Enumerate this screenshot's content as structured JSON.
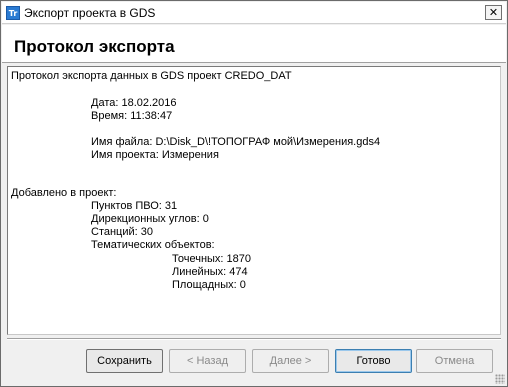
{
  "window": {
    "icon_text": "Tr",
    "title": "Экспорт проекта в GDS",
    "close_glyph": "✕"
  },
  "header": {
    "title": "Протокол экспорта"
  },
  "log": {
    "heading": "Протокол экспорта данных в GDS проект CREDO_DAT",
    "date": "Дата: 18.02.2016",
    "time": "Время: 11:38:47",
    "file_name": "Имя файла: D:\\Disk_D\\!ТОПОГРАФ мой\\Измерения.gds4",
    "project_name": "Имя проекта: Измерения",
    "added_title": "Добавлено в проект:",
    "pvo_points": "Пунктов ПВО: 31",
    "direction_angles": "Дирекционных углов: 0",
    "stations": "Станций: 30",
    "thematic_objects": "Тематических объектов:",
    "point_objects": "Точечных: 1870",
    "linear_objects": "Линейных: 474",
    "area_objects": "Площадных: 0"
  },
  "buttons": {
    "save": "Сохранить",
    "back": "< Назад",
    "next": "Далее >",
    "done": "Готово",
    "cancel": "Отмена"
  }
}
